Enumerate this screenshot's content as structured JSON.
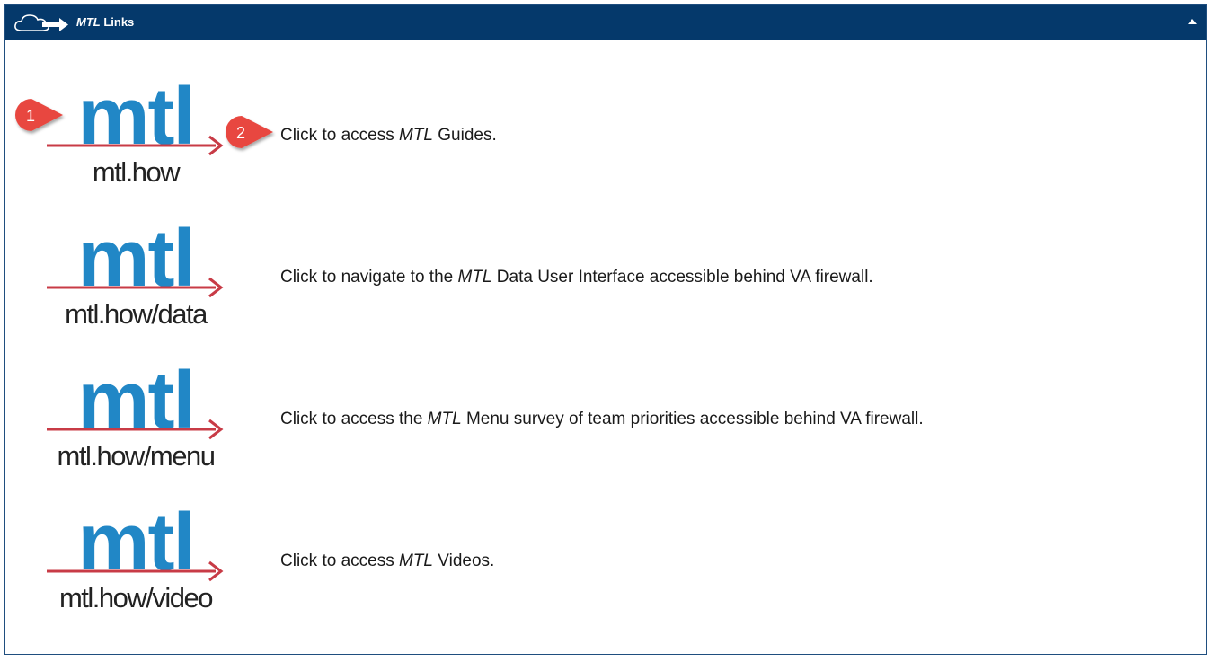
{
  "header": {
    "title_em": "MTL",
    "title_rest": " Links",
    "icon": "cloud-arrow-icon",
    "collapse_icon": "caret-up-icon",
    "bg_color": "#05396b"
  },
  "logo": {
    "word": "mtl",
    "word_color": "#2187c6",
    "arrow_color": "#c83b46"
  },
  "links": [
    {
      "url": "mtl.how",
      "text_pre": "Click to access ",
      "text_em": "MTL",
      "text_post": " Guides."
    },
    {
      "url": "mtl.how/data",
      "text_pre": "Click to navigate to the ",
      "text_em": "MTL",
      "text_post": " Data User Interface accessible behind VA firewall."
    },
    {
      "url": "mtl.how/menu",
      "text_pre": "Click to access the ",
      "text_em": "MTL",
      "text_post": " Menu survey of team priorities accessible behind VA firewall."
    },
    {
      "url": "mtl.how/video",
      "text_pre": "Click to access ",
      "text_em": "MTL",
      "text_post": " Videos."
    }
  ],
  "callouts": [
    {
      "label": "1",
      "color": "#e8473f"
    },
    {
      "label": "2",
      "color": "#e8473f"
    }
  ]
}
